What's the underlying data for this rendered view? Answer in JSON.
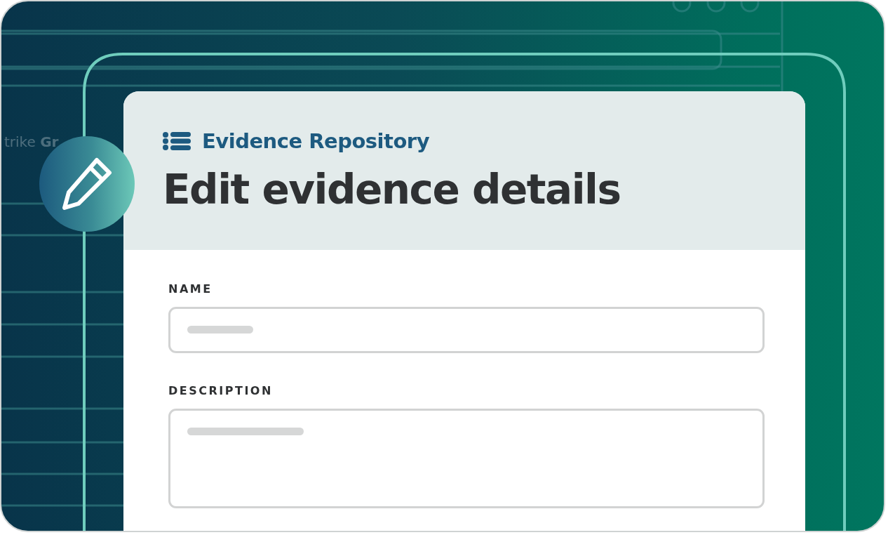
{
  "background": {
    "text": "trike **Gr**"
  },
  "header": {
    "section": "Evidence Repository",
    "title": "Edit evidence details"
  },
  "fields": [
    {
      "label": "NAME",
      "kind": "single-line"
    },
    {
      "label": "DESCRIPTION",
      "kind": "multi-line"
    }
  ]
}
